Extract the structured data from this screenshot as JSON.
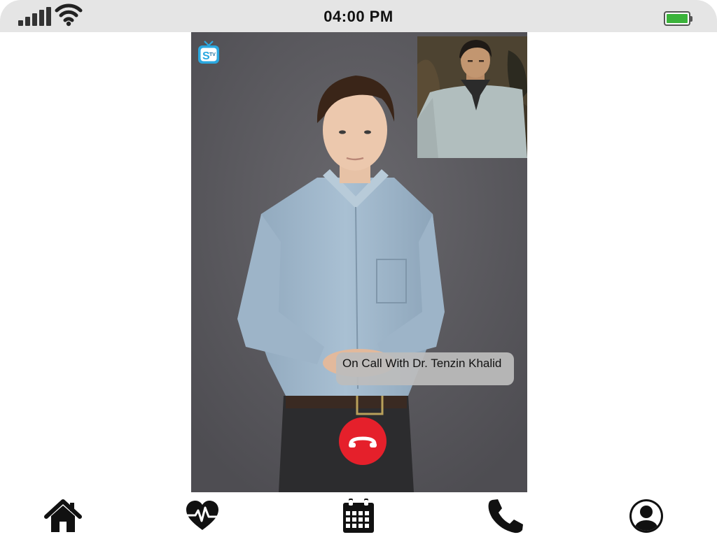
{
  "status_bar": {
    "time": "04:00 PM",
    "signal_icon": "cellular-signal-icon",
    "wifi_icon": "wifi-icon",
    "battery_icon": "battery-icon",
    "battery_level": 1.0,
    "battery_color": "#3bb33b"
  },
  "call": {
    "app_logo_icon": "stv-logo-icon",
    "caption": "On Call With Dr. Tenzin Khalid",
    "end_call_icon": "hang-up-phone-icon",
    "end_call_color": "#e5202b"
  },
  "bottom_nav": {
    "items": [
      {
        "id": "home",
        "icon": "home-icon"
      },
      {
        "id": "health",
        "icon": "heart-pulse-icon"
      },
      {
        "id": "calendar",
        "icon": "calendar-icon"
      },
      {
        "id": "call",
        "icon": "phone-icon"
      },
      {
        "id": "profile",
        "icon": "user-profile-icon"
      }
    ]
  }
}
